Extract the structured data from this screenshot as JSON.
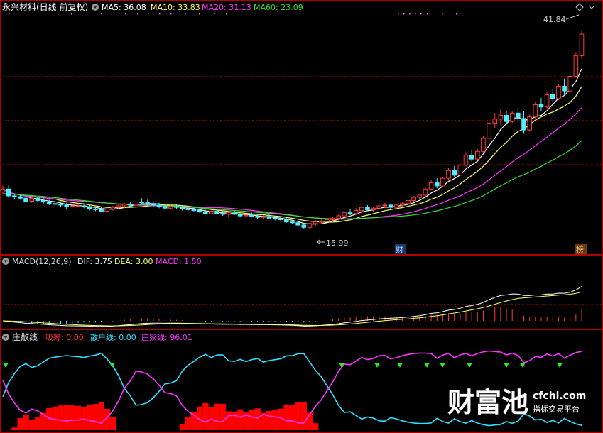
{
  "header": {
    "title": "永兴材料(日线 前复权)",
    "ma5_label": "MA5: 36.08",
    "ma10_label": "MA10: 33.83",
    "ma20_label": "MA20: 31.13",
    "ma60_label": "MA60: 23.09"
  },
  "colors": {
    "up": "#ff3b3b",
    "down": "#4ff0ff",
    "ma5": "#ffffff",
    "ma10": "#ffff66",
    "ma20": "#ff33ff",
    "ma60": "#33dd33",
    "grid": "#7a0000",
    "dif": "#ffffff",
    "dea": "#ffff66",
    "sanhu": "#33ddff",
    "zhuangjia": "#ff33ff",
    "choumao": "#ff0000",
    "signal": "#22ee22",
    "dots": "#ff66ff"
  },
  "annotations": {
    "high_label": "41.84",
    "low_label": "15.99",
    "cai_badge": "财",
    "bang_badge": "榜"
  },
  "macd_panel": {
    "title": "MACD(12,26,9)",
    "dif_label": "DIF: 3.75",
    "dea_label": "DEA: 3.00",
    "macd_label": "MACD: 1.50"
  },
  "zsx_panel": {
    "title": "庄散线",
    "choumao_label": "吸筹: 0.00",
    "sanhu_label": "散户线: 0.00",
    "zhuangjia_label": "庄家线: 96.01"
  },
  "watermark": {
    "logo_text": "财富池",
    "domain": "cfchi.com",
    "slogan": "指标交易平台"
  },
  "chart_data": [
    {
      "type": "candlestick",
      "title": "永兴材料(日线 前复权)",
      "ylim": [
        14,
        44
      ],
      "max_price": 41.84,
      "min_price": 15.99,
      "ohlc": [
        [
          20.8,
          21.6,
          20.6,
          21.2
        ],
        [
          21.2,
          21.7,
          20.0,
          20.3
        ],
        [
          20.3,
          20.6,
          19.9,
          20.2
        ],
        [
          20.2,
          20.5,
          19.8,
          20.0
        ],
        [
          20.0,
          20.6,
          19.2,
          19.6
        ],
        [
          19.6,
          20.2,
          19.4,
          20.0
        ],
        [
          20.0,
          20.1,
          19.5,
          19.7
        ],
        [
          19.7,
          20.1,
          19.3,
          19.5
        ],
        [
          19.5,
          19.8,
          19.1,
          19.3
        ],
        [
          19.3,
          19.6,
          18.9,
          19.2
        ],
        [
          19.2,
          19.5,
          18.8,
          19.1
        ],
        [
          19.1,
          19.4,
          18.6,
          18.9
        ],
        [
          18.9,
          19.2,
          18.7,
          19.0
        ],
        [
          19.0,
          19.3,
          18.8,
          19.0
        ],
        [
          19.0,
          19.3,
          18.7,
          18.9
        ],
        [
          18.9,
          19.1,
          18.4,
          18.6
        ],
        [
          18.6,
          18.9,
          18.3,
          18.5
        ],
        [
          18.5,
          18.8,
          18.2,
          18.3
        ],
        [
          18.3,
          18.7,
          18.1,
          18.6
        ],
        [
          18.6,
          19.0,
          18.4,
          18.8
        ],
        [
          18.8,
          19.2,
          18.6,
          19.0
        ],
        [
          19.0,
          19.4,
          18.7,
          19.2
        ],
        [
          19.2,
          19.5,
          18.8,
          19.1
        ],
        [
          19.1,
          19.7,
          18.9,
          19.5
        ],
        [
          19.5,
          20.0,
          19.2,
          19.4
        ],
        [
          19.4,
          19.8,
          19.0,
          19.3
        ],
        [
          19.3,
          19.6,
          18.9,
          19.1
        ],
        [
          19.1,
          19.4,
          18.7,
          18.9
        ],
        [
          18.9,
          19.2,
          18.5,
          18.7
        ],
        [
          18.7,
          19.1,
          18.5,
          18.9
        ],
        [
          18.9,
          19.2,
          18.6,
          18.8
        ],
        [
          18.8,
          19.0,
          18.4,
          18.6
        ],
        [
          18.6,
          18.9,
          18.3,
          18.5
        ],
        [
          18.5,
          18.8,
          18.2,
          18.4
        ],
        [
          18.4,
          18.6,
          18.1,
          18.2
        ],
        [
          18.2,
          18.5,
          17.9,
          18.0
        ],
        [
          18.0,
          18.4,
          17.9,
          18.3
        ],
        [
          18.3,
          18.5,
          17.9,
          18.0
        ],
        [
          18.0,
          18.3,
          17.7,
          17.9
        ],
        [
          17.9,
          18.2,
          17.6,
          18.1
        ],
        [
          18.1,
          18.4,
          17.8,
          17.9
        ],
        [
          17.9,
          18.1,
          17.5,
          17.7
        ],
        [
          17.7,
          18.0,
          17.4,
          17.8
        ],
        [
          17.8,
          18.1,
          17.5,
          17.6
        ],
        [
          17.6,
          17.9,
          17.3,
          17.5
        ],
        [
          17.5,
          17.8,
          17.2,
          17.6
        ],
        [
          17.6,
          17.9,
          17.3,
          17.4
        ],
        [
          17.4,
          17.7,
          17.1,
          17.3
        ],
        [
          17.3,
          17.6,
          17.0,
          17.2
        ],
        [
          17.2,
          17.4,
          16.8,
          16.9
        ],
        [
          16.9,
          17.2,
          16.6,
          16.8
        ],
        [
          16.8,
          17.0,
          16.4,
          16.5
        ],
        [
          16.5,
          16.8,
          15.99,
          16.2
        ],
        [
          16.2,
          16.8,
          16.0,
          16.7
        ],
        [
          16.7,
          17.1,
          16.4,
          16.9
        ],
        [
          16.9,
          17.2,
          16.6,
          17.0
        ],
        [
          17.0,
          17.4,
          16.7,
          17.2
        ],
        [
          17.2,
          17.6,
          16.9,
          17.4
        ],
        [
          17.4,
          17.9,
          17.1,
          17.7
        ],
        [
          17.7,
          18.3,
          17.5,
          18.1
        ],
        [
          18.1,
          18.6,
          17.8,
          18.0
        ],
        [
          18.0,
          18.7,
          17.8,
          18.4
        ],
        [
          18.4,
          19.0,
          18.2,
          18.8
        ],
        [
          18.8,
          19.1,
          18.3,
          18.5
        ],
        [
          18.5,
          18.9,
          18.2,
          18.7
        ],
        [
          18.7,
          19.2,
          18.5,
          19.0
        ],
        [
          19.0,
          19.4,
          18.7,
          19.1
        ],
        [
          19.1,
          19.3,
          18.6,
          18.8
        ],
        [
          18.8,
          19.2,
          18.6,
          19.1
        ],
        [
          19.1,
          19.5,
          18.9,
          19.3
        ],
        [
          19.3,
          19.9,
          19.1,
          19.7
        ],
        [
          19.7,
          20.3,
          19.5,
          20.1
        ],
        [
          20.1,
          20.6,
          19.8,
          20.4
        ],
        [
          20.4,
          21.5,
          20.2,
          21.2
        ],
        [
          21.2,
          22.4,
          21.0,
          22.0
        ],
        [
          22.0,
          22.6,
          21.3,
          21.6
        ],
        [
          21.6,
          22.8,
          21.5,
          22.6
        ],
        [
          22.6,
          23.9,
          22.4,
          23.6
        ],
        [
          23.6,
          24.2,
          22.8,
          23.0
        ],
        [
          23.0,
          24.6,
          22.9,
          24.3
        ],
        [
          24.3,
          26.0,
          24.1,
          25.6
        ],
        [
          25.6,
          26.3,
          24.8,
          25.1
        ],
        [
          25.1,
          26.4,
          24.9,
          26.1
        ],
        [
          26.1,
          28.1,
          25.9,
          27.8
        ],
        [
          27.8,
          30.2,
          27.6,
          29.8
        ],
        [
          29.8,
          31.1,
          29.2,
          30.3
        ],
        [
          30.3,
          31.6,
          29.5,
          30.8
        ],
        [
          30.8,
          31.3,
          29.6,
          30.0
        ],
        [
          30.0,
          31.4,
          29.8,
          31.1
        ],
        [
          31.1,
          31.8,
          29.9,
          30.4
        ],
        [
          30.4,
          31.4,
          28.4,
          28.9
        ],
        [
          28.9,
          30.9,
          28.7,
          30.6
        ],
        [
          30.6,
          32.6,
          30.4,
          32.2
        ],
        [
          32.2,
          33.1,
          31.4,
          31.9
        ],
        [
          31.9,
          33.8,
          31.7,
          33.5
        ],
        [
          33.5,
          34.3,
          32.6,
          33.0
        ],
        [
          33.0,
          34.9,
          32.8,
          34.6
        ],
        [
          34.6,
          35.6,
          33.4,
          34.0
        ],
        [
          34.0,
          36.3,
          33.8,
          35.9
        ],
        [
          35.9,
          38.9,
          35.7,
          38.6
        ],
        [
          38.6,
          41.84,
          38.2,
          41.4
        ]
      ]
    },
    {
      "type": "line",
      "title": "MACD(12,26,9)",
      "series": [
        {
          "name": "DIF",
          "last": 3.75
        },
        {
          "name": "DEA",
          "last": 3.0
        },
        {
          "name": "MACD",
          "last": 1.5
        }
      ]
    },
    {
      "type": "line",
      "title": "庄散线",
      "ylim": [
        0,
        100
      ],
      "series": [
        {
          "name": "散户线",
          "last": 0.0
        },
        {
          "name": "庄家线",
          "last": 96.01
        },
        {
          "name": "吸筹",
          "last": 0.0
        }
      ]
    }
  ]
}
